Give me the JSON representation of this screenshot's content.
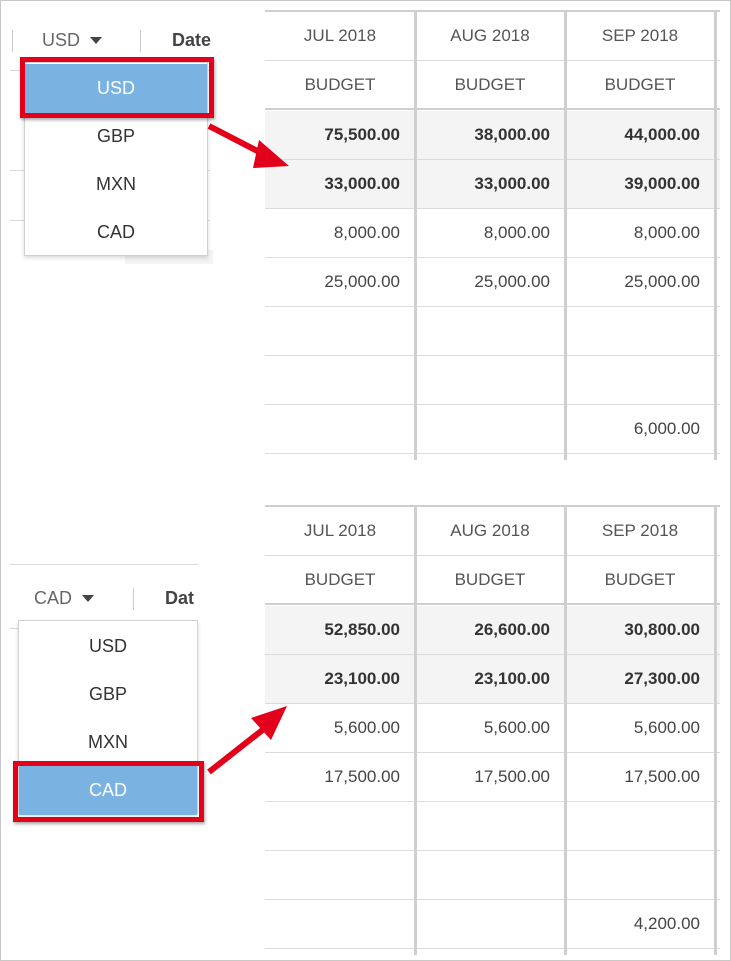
{
  "colors": {
    "selected": "#7ab3e2",
    "highlight": "#e3001b",
    "arrow": "#e3001b"
  },
  "usd_view": {
    "currency_value": "USD",
    "date_label": "Date",
    "options": [
      "USD",
      "GBP",
      "MXN",
      "CAD"
    ],
    "selected_option": "USD",
    "months": [
      "JUL 2018",
      "AUG 2018",
      "SEP 2018"
    ],
    "subheaders": [
      "BUDGET",
      "BUDGET",
      "BUDGET"
    ],
    "rows": [
      {
        "bold": true,
        "values": [
          "75,500.00",
          "38,000.00",
          "44,000.00"
        ]
      },
      {
        "bold": true,
        "values": [
          "33,000.00",
          "33,000.00",
          "39,000.00"
        ]
      },
      {
        "bold": false,
        "values": [
          "8,000.00",
          "8,000.00",
          "8,000.00"
        ]
      },
      {
        "bold": false,
        "values": [
          "25,000.00",
          "25,000.00",
          "25,000.00"
        ]
      },
      {
        "bold": false,
        "values": [
          "",
          "",
          ""
        ]
      },
      {
        "bold": false,
        "values": [
          "",
          "",
          ""
        ]
      },
      {
        "bold": false,
        "values": [
          "",
          "",
          "6,000.00"
        ]
      }
    ]
  },
  "cad_view": {
    "currency_value": "CAD",
    "date_label": "Dat",
    "options": [
      "USD",
      "GBP",
      "MXN",
      "CAD"
    ],
    "selected_option": "CAD",
    "months": [
      "JUL 2018",
      "AUG 2018",
      "SEP 2018"
    ],
    "subheaders": [
      "BUDGET",
      "BUDGET",
      "BUDGET"
    ],
    "rows": [
      {
        "bold": true,
        "values": [
          "52,850.00",
          "26,600.00",
          "30,800.00"
        ]
      },
      {
        "bold": true,
        "values": [
          "23,100.00",
          "23,100.00",
          "27,300.00"
        ]
      },
      {
        "bold": false,
        "values": [
          "5,600.00",
          "5,600.00",
          "5,600.00"
        ]
      },
      {
        "bold": false,
        "values": [
          "17,500.00",
          "17,500.00",
          "17,500.00"
        ]
      },
      {
        "bold": false,
        "values": [
          "",
          "",
          ""
        ]
      },
      {
        "bold": false,
        "values": [
          "",
          "",
          ""
        ]
      },
      {
        "bold": false,
        "values": [
          "",
          "",
          "4,200.00"
        ]
      }
    ]
  }
}
